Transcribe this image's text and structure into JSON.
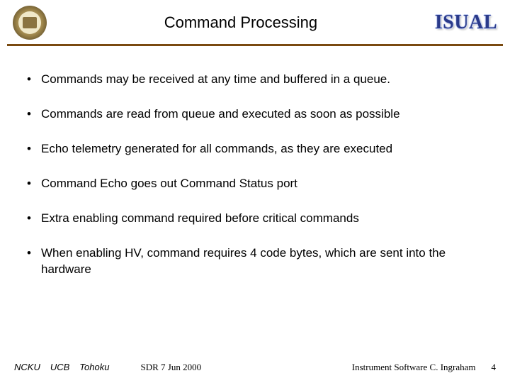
{
  "header": {
    "title": "Command Processing",
    "brand": "ISUAL"
  },
  "bullets": [
    "Commands may be received at any time and buffered in a queue.",
    "Commands are read from queue and executed as soon as possible",
    "Echo telemetry generated for all commands, as they are executed",
    "Command Echo goes out Command Status port",
    "Extra enabling command required before critical commands",
    "When enabling HV, command requires 4 code bytes, which are sent into the hardware"
  ],
  "footer": {
    "affiliations": [
      "NCKU",
      "UCB",
      "Tohoku"
    ],
    "event": "SDR 7 Jun 2000",
    "credit": "Instrument Software   C. Ingraham",
    "page": "4"
  }
}
